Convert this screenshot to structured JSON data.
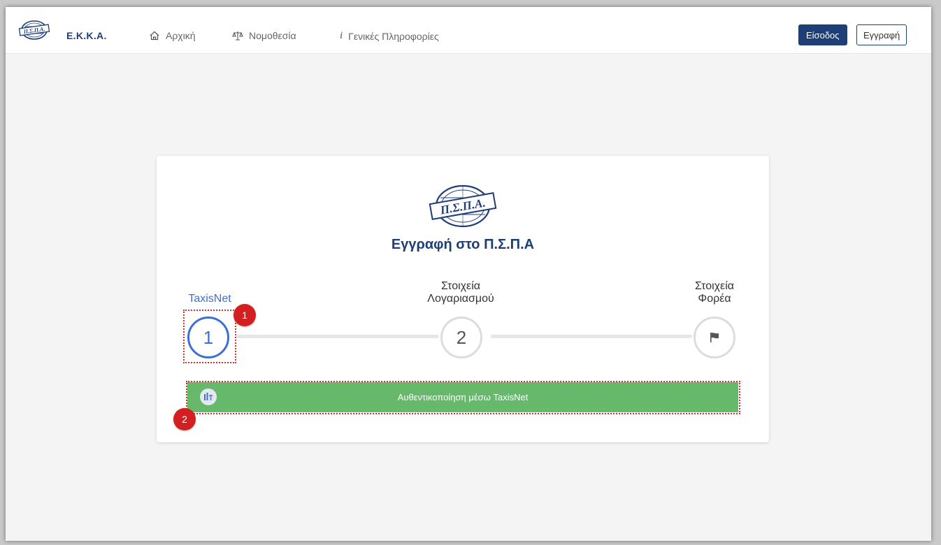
{
  "header": {
    "brand": "Ε.Κ.Κ.Α.",
    "logo_text": "Π.Σ.Π.Α.",
    "nav": [
      {
        "label": "Αρχική",
        "icon": "home-icon"
      },
      {
        "label": "Νομοθεσία",
        "icon": "scales-icon"
      },
      {
        "label": "Γενικές Πληροφορίες",
        "icon": "info-icon"
      }
    ],
    "login_label": "Είσοδος",
    "register_label": "Εγγραφή"
  },
  "card": {
    "logo_text": "Π.Σ.Π.Α.",
    "title": "Εγγραφή στο Π.Σ.Π.Α",
    "steps": [
      {
        "label": "TaxisNet",
        "number": "1",
        "state": "active"
      },
      {
        "label_line1": "Στοιχεία",
        "label_line2": "Λογαριασμού",
        "number": "2",
        "state": "pending"
      },
      {
        "label_line1": "Στοιχεία",
        "label_line2": "Φορέα",
        "icon": "flag-icon",
        "state": "pending"
      }
    ],
    "taxis_button_label": "Αυθεντικοποίηση μέσω TaxisNet"
  },
  "annotations": {
    "badge_1": "1",
    "badge_2": "2"
  },
  "colors": {
    "primary": "#1e3e77",
    "active_step": "#3b6fd8",
    "taxis_button": "#66b96a",
    "annotation_red": "#d31f1f"
  }
}
